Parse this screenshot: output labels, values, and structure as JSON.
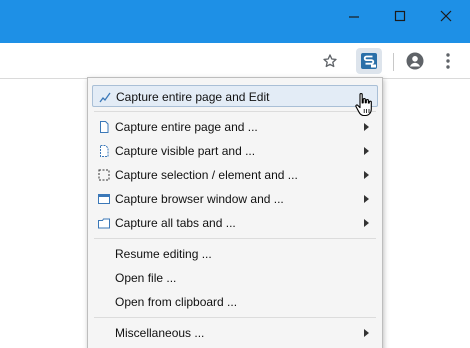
{
  "window": {
    "controls": [
      "minimize-icon",
      "maximize-icon",
      "close-icon"
    ],
    "titlebar_color": "#1e90e6"
  },
  "toolbar": {
    "icons": [
      "star-icon",
      "extension-icon",
      "account-icon",
      "more-vert-icon"
    ]
  },
  "menu": {
    "highlight_color": "#e3ecf6",
    "items": [
      {
        "label": "Capture entire page and Edit",
        "icon": "edit-capture-icon",
        "submenu": false,
        "highlighted": true
      },
      {
        "label": "Capture entire page and ...",
        "icon": "page-icon",
        "submenu": true
      },
      {
        "label": "Capture visible part and ...",
        "icon": "visible-part-icon",
        "submenu": true
      },
      {
        "label": "Capture selection / element and ...",
        "icon": "selection-icon",
        "submenu": true
      },
      {
        "label": "Capture browser window and ...",
        "icon": "browser-window-icon",
        "submenu": true
      },
      {
        "label": "Capture all tabs and ...",
        "icon": "all-tabs-icon",
        "submenu": true
      },
      {
        "label": "Resume editing ...",
        "submenu": false
      },
      {
        "label": "Open file ...",
        "submenu": false
      },
      {
        "label": "Open from clipboard ...",
        "submenu": false
      },
      {
        "label": "Miscellaneous ...",
        "submenu": true
      }
    ]
  }
}
